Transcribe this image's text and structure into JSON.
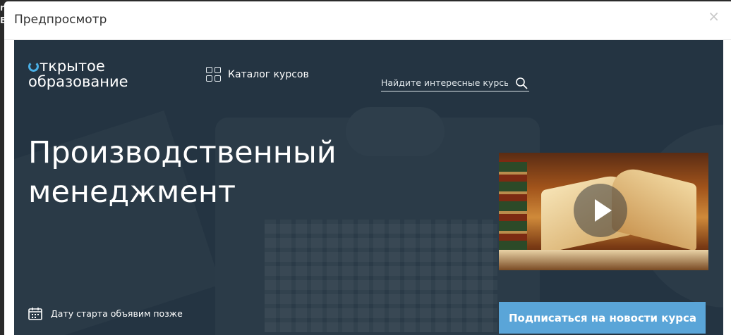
{
  "background_fragments": [
    "r",
    "E"
  ],
  "modal": {
    "title": "Предпросмотр",
    "close_label": "×"
  },
  "preview": {
    "logo": {
      "line1": "ткрытое",
      "line2": "образование",
      "accent_color": "#4ab0e6"
    },
    "catalog_label": "Каталог курсов",
    "search": {
      "placeholder": "Найдите интересные курсы",
      "value": ""
    },
    "course_title_line1": "Производственный",
    "course_title_line2": "менеджмент",
    "start_date_text": "Дату старта объявим позже",
    "subscribe_label": "Подписаться на новости курса",
    "colors": {
      "background": "#243442",
      "button": "#5aa5d8"
    },
    "icons": [
      "grid-icon",
      "search-icon",
      "calendar-icon",
      "play-icon"
    ]
  }
}
